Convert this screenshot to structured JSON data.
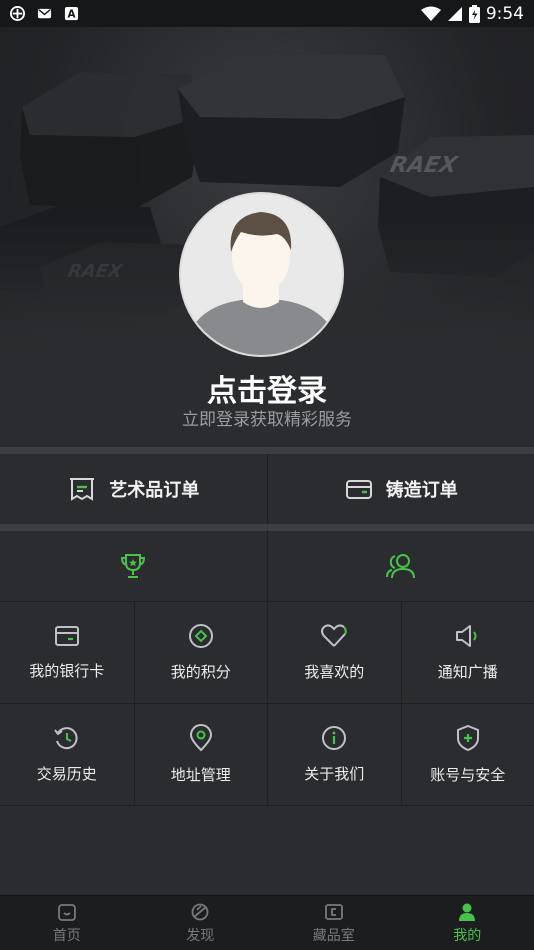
{
  "status_bar": {
    "time": "9:54",
    "icons": [
      "notification-app-icon",
      "mail-icon",
      "text-app-icon",
      "wifi-icon",
      "signal-icon",
      "battery-icon"
    ]
  },
  "hero": {
    "brand_watermark": "RAEX",
    "login_title": "点击登录",
    "login_subtitle": "立即登录获取精彩服务"
  },
  "orders": [
    {
      "label": "艺术品订单",
      "icon": "receipt-icon"
    },
    {
      "label": "铸造订单",
      "icon": "box-icon"
    }
  ],
  "top_row": [
    {
      "icon": "trophy-icon"
    },
    {
      "icon": "users-icon"
    }
  ],
  "grid_row1": [
    {
      "label": "我的银行卡",
      "icon": "bank-card-icon"
    },
    {
      "label": "我的积分",
      "icon": "points-icon"
    },
    {
      "label": "我喜欢的",
      "icon": "heart-icon"
    },
    {
      "label": "通知广播",
      "icon": "speaker-icon"
    }
  ],
  "grid_row2": [
    {
      "label": "交易历史",
      "icon": "history-icon"
    },
    {
      "label": "地址管理",
      "icon": "location-pin-icon"
    },
    {
      "label": "关于我们",
      "icon": "info-icon"
    },
    {
      "label": "账号与安全",
      "icon": "shield-icon"
    }
  ],
  "tabbar": [
    {
      "label": "首页",
      "icon": "home-icon",
      "active": false
    },
    {
      "label": "发现",
      "icon": "discover-icon",
      "active": false
    },
    {
      "label": "藏品室",
      "icon": "collection-icon",
      "active": false
    },
    {
      "label": "我的",
      "icon": "profile-icon",
      "active": true
    }
  ],
  "colors": {
    "accent": "#48c24a",
    "icon_gray": "#bfc1c4",
    "background": "#2a2c2f"
  }
}
